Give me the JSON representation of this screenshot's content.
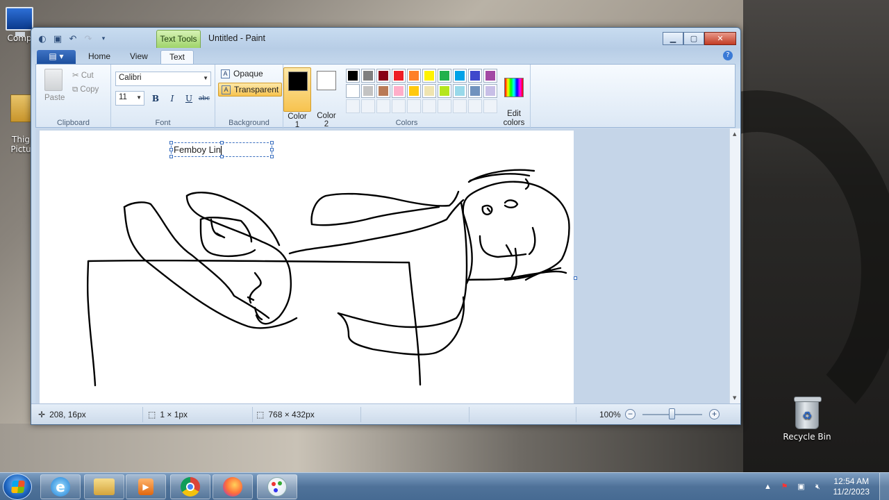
{
  "desktop": {
    "icons": [
      {
        "label": "Comp"
      },
      {
        "label": "Thig\nPictu"
      },
      {
        "label": "Recycle Bin"
      }
    ]
  },
  "window": {
    "title": "Untitled - Paint",
    "context_tab": "Text Tools",
    "tabs": [
      "Home",
      "View",
      "Text"
    ],
    "active_tab": "Text"
  },
  "ribbon": {
    "clipboard": {
      "label": "Clipboard",
      "paste": "Paste",
      "cut": "Cut",
      "copy": "Copy"
    },
    "font": {
      "label": "Font",
      "family": "Calibri",
      "size": "11",
      "bold": "B",
      "italic": "I",
      "underline": "U",
      "strike": "abc"
    },
    "background": {
      "label": "Background",
      "opaque": "Opaque",
      "transparent": "Transparent",
      "selected": "Transparent"
    },
    "colors": {
      "label": "Colors",
      "color1_label": "Color\n1",
      "color2_label": "Color\n2",
      "color1": "#000000",
      "color2": "#ffffff",
      "edit_label": "Edit\ncolors",
      "palette": [
        "#000000",
        "#7f7f7f",
        "#880015",
        "#ed1c24",
        "#ff7f27",
        "#fff200",
        "#22b14c",
        "#00a2e8",
        "#3f48cc",
        "#a349a4",
        "#ffffff",
        "#c3c3c3",
        "#b97a57",
        "#ffaec9",
        "#ffc90e",
        "#efe4b0",
        "#b5e61d",
        "#99d9ea",
        "#7092be",
        "#c8bfe7"
      ]
    }
  },
  "canvas": {
    "text_box": "Femboy Lin"
  },
  "status": {
    "cursor_pos": "208, 16px",
    "selection_size": "1 × 1px",
    "image_size": "768 × 432px",
    "zoom": "100%"
  },
  "taskbar": {
    "clock_time": "12:54 AM",
    "clock_date": "11/2/2023"
  }
}
